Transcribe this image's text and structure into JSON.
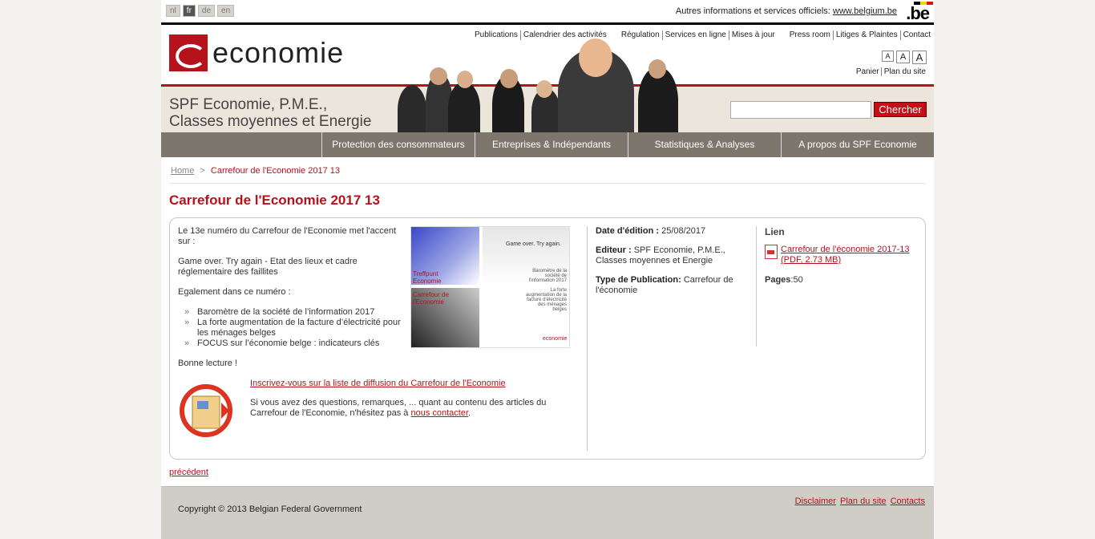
{
  "languages": [
    {
      "code": "nl",
      "active": false
    },
    {
      "code": "fr",
      "active": true
    },
    {
      "code": "de",
      "active": false
    },
    {
      "code": "en",
      "active": false
    }
  ],
  "official": {
    "text": "Autres informations et services officiels:",
    "link": "www.belgium.be",
    "logo": ".be"
  },
  "logo_text": "economie",
  "topnav": [
    "Publications",
    "Calendrier des activités",
    "Régulation",
    "Services en ligne",
    "Mises à jour",
    "Press room",
    "Litiges & Plaintes",
    "Contact"
  ],
  "fontsize": [
    "A",
    "A",
    "A"
  ],
  "util": {
    "cart": "Panier",
    "sitemap": "Plan du site"
  },
  "banner": {
    "line1": "SPF Economie, P.M.E.,",
    "line2": "Classes moyennes et Energie"
  },
  "search": {
    "value": "",
    "button": "Chercher"
  },
  "mainnav": [
    "Protection des consommateurs",
    "Entreprises & Indépendants",
    "Statistiques & Analyses",
    "A propos du SPF Economie"
  ],
  "breadcrumb": {
    "home": "Home",
    "separator": ">",
    "current": "Carrefour de l'Economie 2017 13"
  },
  "title": "Carrefour de l'Economie 2017 13",
  "content": {
    "intro": "Le 13e numéro du Carrefour de l'Economie met l'accent sur :",
    "focus": "Game over. Try again - Etat des lieux et cadre réglementaire des faillites",
    "also": "Egalement dans ce numéro :",
    "items": [
      "Baromètre de la société de l’information 2017",
      "La forte augmentation de la facture d’électricité pour les ménages belges",
      "FOCUS sur l’économie belge : indicateurs clés"
    ],
    "closing": "Bonne lecture !",
    "subscribe_link": "Inscrivez-vous sur la liste de diffusion du Carrefour de l'Economie",
    "questions_text": "Si vous avez des questions, remarques, ... quant au contenu des articles du Carrefour de l'Economie, n'hésitez pas à",
    "contact_link": "nous contacter",
    "cover": {
      "t1": "Game over. Try again.",
      "t2": "Treffpunt Economie",
      "t3": "Carrefour de l'Economie",
      "t4": "Baromètre de la société de l'information 2017",
      "t5": "La forte augmentation de la facture d'électricité des ménages belges",
      "t6": "economie"
    }
  },
  "meta": {
    "date_label": "Date d'édition :",
    "date": "25/08/2017",
    "editor_label": "Editeur :",
    "editor": "SPF Economie, P.M.E., Classes moyennes et Energie",
    "type_label": "Type de Publication:",
    "type": "Carrefour de l'économie"
  },
  "link_section": {
    "heading": "Lien",
    "file": "Carrefour de l'économie 2017-13 (PDF, 2.73 MB)",
    "pages_label": "Pages",
    "pages": ":50"
  },
  "previous": "précédent",
  "footer": {
    "copyright": "Copyright © 2013 Belgian Federal Government",
    "links": [
      "Disclaimer",
      "Plan du site",
      "Contacts"
    ]
  }
}
